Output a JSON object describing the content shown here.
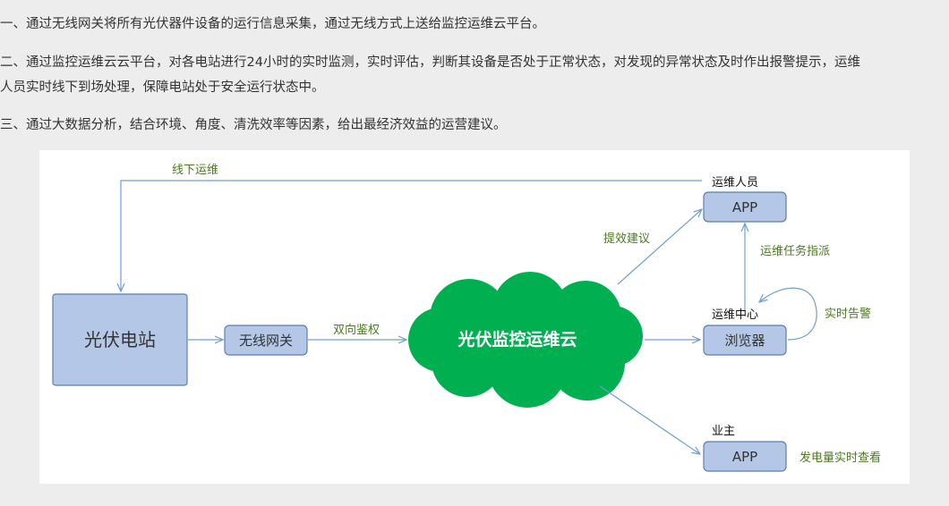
{
  "intro": {
    "p1": "一、通过无线网关将所有光伏器件设备的运行信息采集，通过无线方式上送给监控运维云平台。",
    "p2_line1": "二、通过监控运维云云平台，对各电站进行24小时的实时监测，实时评估，判断其设备是否处于正常状态，对发现的异常状态及时作出报警提示，运维",
    "p2_line2": "人员实时线下到场处理，保障电站处于安全运行状态中。",
    "p3": "三、通过大数据分析，结合环境、角度、清洗效率等因素，给出最经济效益的运营建议。"
  },
  "diagram": {
    "nodes": {
      "station": "光伏电站",
      "gateway": "无线网关",
      "cloud": "光伏监控运维云",
      "ops_app": "APP",
      "browser": "浏览器",
      "owner_app": "APP"
    },
    "node_titles": {
      "ops_staff": "运维人员",
      "ops_center": "运维中心",
      "owner": "业主"
    },
    "edge_labels": {
      "offline_ops": "线下运维",
      "two_way_auth": "双向鉴权",
      "efficiency_advice": "提效建议",
      "task_dispatch": "运维任务指派",
      "realtime_alarm": "实时告警",
      "generation_view": "发电量实时查看"
    },
    "colors": {
      "box_fill": "#b4c7e7",
      "box_stroke": "#5b7fae",
      "cloud_fill": "#00b050",
      "arrow": "#6f9fd0",
      "edge_label": "#4a7a1f"
    }
  }
}
